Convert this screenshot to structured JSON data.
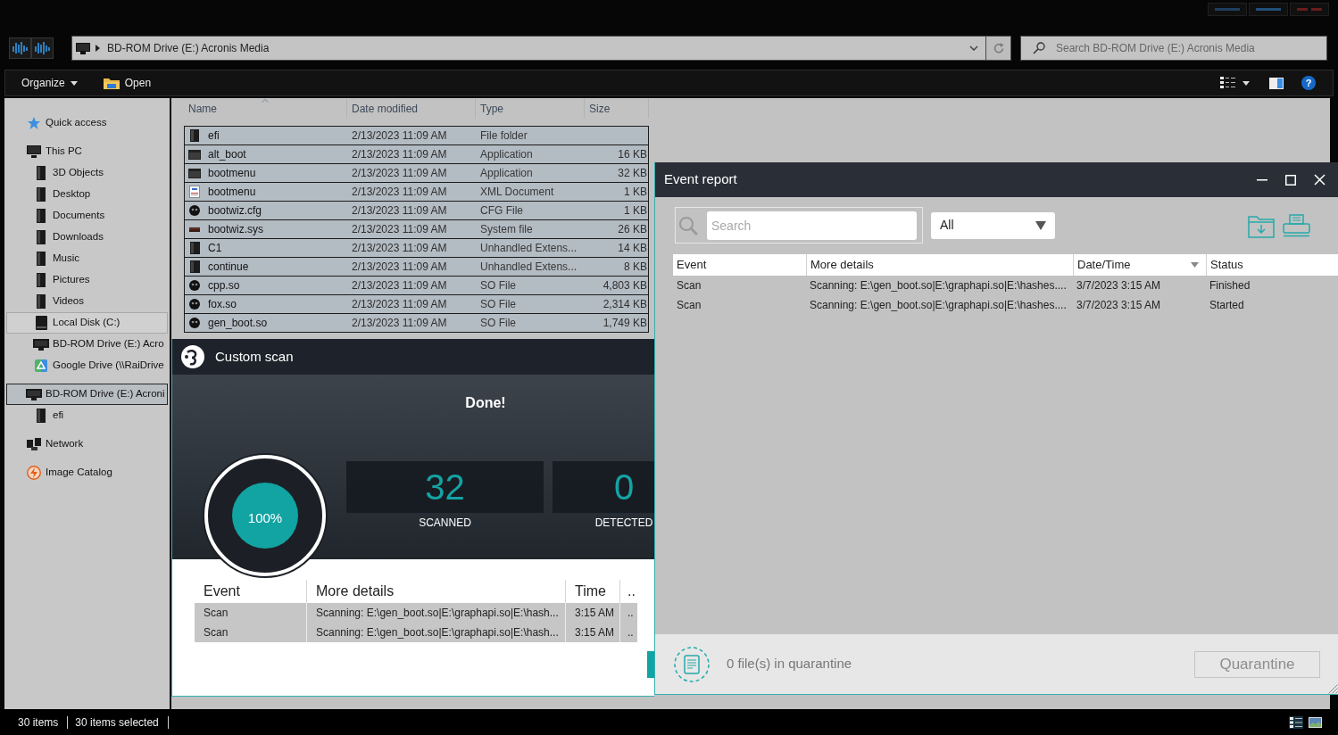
{
  "nav": {
    "address": "BD-ROM Drive (E:) Acronis Media",
    "search_placeholder": "Search BD-ROM Drive (E:) Acronis Media"
  },
  "toolbar": {
    "organize": "Organize",
    "open": "Open",
    "help": "?"
  },
  "sidebar": {
    "items": [
      {
        "label": "Quick access",
        "kind": "star",
        "selected": false,
        "hovered": false
      },
      {
        "label": "This PC",
        "kind": "pc",
        "selected": false,
        "hovered": false,
        "children": [
          {
            "label": "3D Objects",
            "kind": "folder",
            "selected": false,
            "hovered": false
          },
          {
            "label": "Desktop",
            "kind": "folder",
            "selected": false,
            "hovered": false
          },
          {
            "label": "Documents",
            "kind": "folder",
            "selected": false,
            "hovered": false
          },
          {
            "label": "Downloads",
            "kind": "folder",
            "selected": false,
            "hovered": false
          },
          {
            "label": "Music",
            "kind": "folder",
            "selected": false,
            "hovered": false
          },
          {
            "label": "Pictures",
            "kind": "folder",
            "selected": false,
            "hovered": false
          },
          {
            "label": "Videos",
            "kind": "folder",
            "selected": false,
            "hovered": false
          },
          {
            "label": "Local Disk (C:)",
            "kind": "disk",
            "selected": false,
            "hovered": true
          },
          {
            "label": "BD-ROM Drive (E:) Acro",
            "kind": "drive",
            "selected": false,
            "hovered": false
          },
          {
            "label": "Google Drive (\\\\RaiDrive",
            "kind": "cloud",
            "selected": false,
            "hovered": false
          }
        ]
      },
      {
        "label": "BD-ROM Drive (E:) Acroni",
        "kind": "drive",
        "selected": true,
        "hovered": false,
        "children": [
          {
            "label": "efi",
            "kind": "folder",
            "selected": false,
            "hovered": false
          }
        ]
      },
      {
        "label": "Network",
        "kind": "network",
        "selected": false,
        "hovered": false
      },
      {
        "label": "Image Catalog",
        "kind": "catalog",
        "selected": false,
        "hovered": false
      }
    ]
  },
  "files": {
    "columns": [
      {
        "label": "Name",
        "sorted": true
      },
      {
        "label": "Date modified",
        "sorted": false
      },
      {
        "label": "Type",
        "sorted": false
      },
      {
        "label": "Size",
        "sorted": false
      }
    ],
    "rows": [
      {
        "name": "efi",
        "date": "2/13/2023 11:09 AM",
        "type": "File folder",
        "kind": "folder",
        "selected": true
      },
      {
        "name": "alt_boot",
        "date": "2/13/2023 11:09 AM",
        "type": "Application",
        "size": "16 KB",
        "kind": "app",
        "selected": true
      },
      {
        "name": "bootmenu",
        "date": "2/13/2023 11:09 AM",
        "type": "Application",
        "size": "32 KB",
        "kind": "app",
        "selected": true
      },
      {
        "name": "bootmenu",
        "date": "2/13/2023 11:09 AM",
        "type": "XML Document",
        "size": "1 KB",
        "kind": "xml",
        "selected": true
      },
      {
        "name": "bootwiz.cfg",
        "date": "2/13/2023 11:09 AM",
        "type": "CFG File",
        "size": "1 KB",
        "kind": "round",
        "selected": true
      },
      {
        "name": "bootwiz.sys",
        "date": "2/13/2023 11:09 AM",
        "type": "System file",
        "size": "26 KB",
        "kind": "sys",
        "selected": true
      },
      {
        "name": "C1",
        "date": "2/13/2023 11:09 AM",
        "type": "Unhandled Extens...",
        "size": "14 KB",
        "kind": "blank",
        "selected": true
      },
      {
        "name": "continue",
        "date": "2/13/2023 11:09 AM",
        "type": "Unhandled Extens...",
        "size": "8 KB",
        "kind": "blank",
        "selected": true
      },
      {
        "name": "cpp.so",
        "date": "2/13/2023 11:09 AM",
        "type": "SO File",
        "size": "4,803 KB",
        "kind": "round",
        "selected": true
      },
      {
        "name": "fox.so",
        "date": "2/13/2023 11:09 AM",
        "type": "SO File",
        "size": "2,314 KB",
        "kind": "round",
        "selected": true
      },
      {
        "name": "gen_boot.so",
        "date": "2/13/2023 11:09 AM",
        "type": "SO File",
        "size": "1,749 KB",
        "kind": "round",
        "selected": true
      }
    ]
  },
  "status_bar": {
    "items": [
      "30 items",
      "30 items selected"
    ]
  },
  "scan": {
    "title": "Custom scan",
    "headline": "Done!",
    "progress": {
      "level": 1,
      "reading": "100%"
    },
    "stats": [
      {
        "value": "32",
        "label": "SCANNED"
      },
      {
        "value": "0",
        "label": "DETECTED"
      }
    ],
    "table": {
      "columns": [
        "Event",
        "More details",
        "Time",
        ".."
      ],
      "rows": [
        [
          "Scan",
          "Scanning: E:\\gen_boot.so|E:\\graphapi.so|E:\\hash...",
          "3:15 AM",
          ".."
        ],
        [
          "Scan",
          "Scanning: E:\\gen_boot.so|E:\\graphapi.so|E:\\hash...",
          "3:15 AM",
          ".."
        ]
      ]
    }
  },
  "event_report": {
    "title": "Event report",
    "search_placeholder": "Search",
    "filter": "All",
    "table": {
      "columns": [
        {
          "label": "Event",
          "sorted": false
        },
        {
          "label": "More details",
          "sorted": false
        },
        {
          "label": "Date/Time",
          "sorted": true
        },
        {
          "label": "Status",
          "sorted": false
        }
      ],
      "rows": [
        [
          "Scan",
          "Scanning: E:\\gen_boot.so|E:\\graphapi.so|E:\\hashes....",
          "3/7/2023 3:15 AM",
          "Finished"
        ],
        [
          "Scan",
          "Scanning: E:\\gen_boot.so|E:\\graphapi.so|E:\\hashes....",
          "3/7/2023 3:15 AM",
          "Started"
        ]
      ]
    },
    "quarantine": {
      "text": "0 file(s) in quarantine",
      "button": "Quarantine",
      "disabled": true
    }
  }
}
